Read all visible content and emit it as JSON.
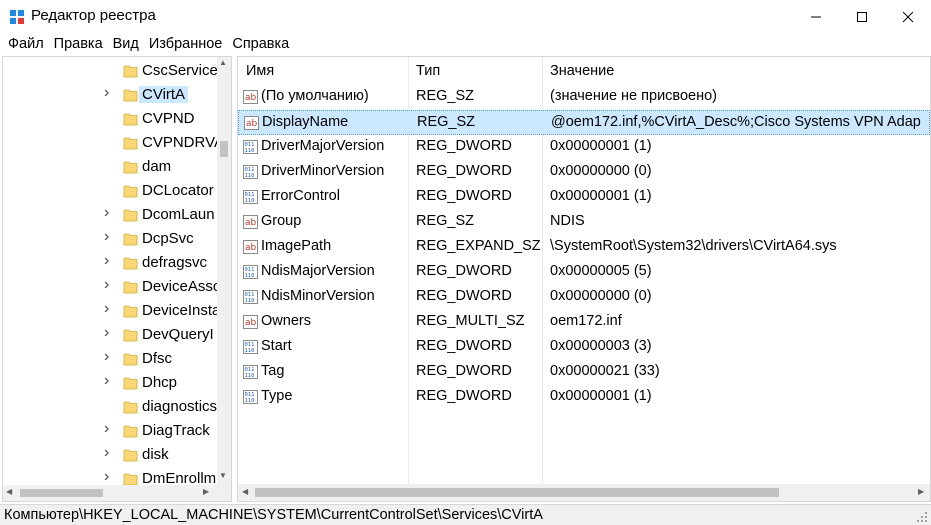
{
  "window": {
    "title": "Редактор реестра",
    "app_icon": "regedit-icon",
    "buttons": {
      "minimize": "minimize-icon",
      "maximize": "maximize-icon",
      "close": "close-icon"
    }
  },
  "menu": [
    "Файл",
    "Правка",
    "Вид",
    "Избранное",
    "Справка"
  ],
  "tree": {
    "items": [
      {
        "label": "CscService",
        "expandable": false
      },
      {
        "label": "CVirtA",
        "expandable": true,
        "selected": true
      },
      {
        "label": "CVPND",
        "expandable": false
      },
      {
        "label": "CVPNDRVA",
        "expandable": false
      },
      {
        "label": "dam",
        "expandable": false
      },
      {
        "label": "DCLocator",
        "expandable": false
      },
      {
        "label": "DcomLaun",
        "expandable": true
      },
      {
        "label": "DcpSvc",
        "expandable": true
      },
      {
        "label": "defragsvc",
        "expandable": true
      },
      {
        "label": "DeviceAsso",
        "expandable": true
      },
      {
        "label": "DeviceInsta",
        "expandable": true
      },
      {
        "label": "DevQueryI",
        "expandable": true
      },
      {
        "label": "Dfsc",
        "expandable": true
      },
      {
        "label": "Dhcp",
        "expandable": true
      },
      {
        "label": "diagnostics",
        "expandable": false
      },
      {
        "label": "DiagTrack",
        "expandable": true
      },
      {
        "label": "disk",
        "expandable": true
      },
      {
        "label": "DmEnrollm",
        "expandable": true
      }
    ]
  },
  "list": {
    "columns": {
      "name": "Имя",
      "type": "Тип",
      "data": "Значение"
    },
    "rows": [
      {
        "icon": "string-value-icon",
        "name": "(По умолчанию)",
        "type": "REG_SZ",
        "data": "(значение не присвоено)"
      },
      {
        "icon": "string-value-icon",
        "name": "DisplayName",
        "type": "REG_SZ",
        "data": "@oem172.inf,%CVirtA_Desc%;Cisco Systems VPN Adap",
        "selected": true
      },
      {
        "icon": "binary-value-icon",
        "name": "DriverMajorVersion",
        "type": "REG_DWORD",
        "data": "0x00000001 (1)"
      },
      {
        "icon": "binary-value-icon",
        "name": "DriverMinorVersion",
        "type": "REG_DWORD",
        "data": "0x00000000 (0)"
      },
      {
        "icon": "binary-value-icon",
        "name": "ErrorControl",
        "type": "REG_DWORD",
        "data": "0x00000001 (1)"
      },
      {
        "icon": "string-value-icon",
        "name": "Group",
        "type": "REG_SZ",
        "data": "NDIS"
      },
      {
        "icon": "string-value-icon",
        "name": "ImagePath",
        "type": "REG_EXPAND_SZ",
        "data": "\\SystemRoot\\System32\\drivers\\CVirtA64.sys"
      },
      {
        "icon": "binary-value-icon",
        "name": "NdisMajorVersion",
        "type": "REG_DWORD",
        "data": "0x00000005 (5)"
      },
      {
        "icon": "binary-value-icon",
        "name": "NdisMinorVersion",
        "type": "REG_DWORD",
        "data": "0x00000000 (0)"
      },
      {
        "icon": "string-value-icon",
        "name": "Owners",
        "type": "REG_MULTI_SZ",
        "data": "oem172.inf"
      },
      {
        "icon": "binary-value-icon",
        "name": "Start",
        "type": "REG_DWORD",
        "data": "0x00000003 (3)"
      },
      {
        "icon": "binary-value-icon",
        "name": "Tag",
        "type": "REG_DWORD",
        "data": "0x00000021 (33)"
      },
      {
        "icon": "binary-value-icon",
        "name": "Type",
        "type": "REG_DWORD",
        "data": "0x00000001 (1)"
      }
    ]
  },
  "status": {
    "path": "Компьютер\\HKEY_LOCAL_MACHINE\\SYSTEM\\CurrentControlSet\\Services\\CVirtA"
  },
  "colors": {
    "selection": "#cce8ff",
    "folder": "#f8d775",
    "scrollbar": "#f0f0f0"
  }
}
